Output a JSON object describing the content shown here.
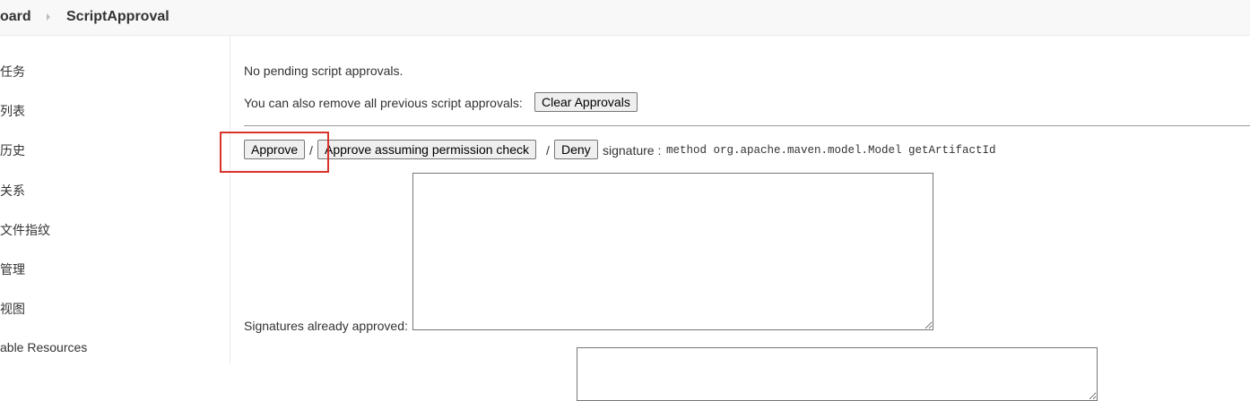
{
  "breadcrumb": {
    "items": [
      "oard",
      "ScriptApproval"
    ]
  },
  "sidebar": {
    "items": [
      "任务",
      "列表",
      "历史",
      "关系",
      "文件指纹",
      "管理",
      "视图",
      "able Resources"
    ]
  },
  "main": {
    "no_pending": "No pending script approvals.",
    "remove_text": "You can also remove all previous script approvals:",
    "clear_button": "Clear Approvals",
    "approve_button": "Approve",
    "slash1": "/",
    "approve_assuming_button": "Approve assuming permission check",
    "slash2": "/",
    "deny_button": "Deny",
    "signature_label": "signature :",
    "signature_value": "method org.apache.maven.model.Model getArtifactId",
    "signatures_approved_label": "Signatures already approved:"
  },
  "colors": {
    "highlight": "#d9342b"
  }
}
